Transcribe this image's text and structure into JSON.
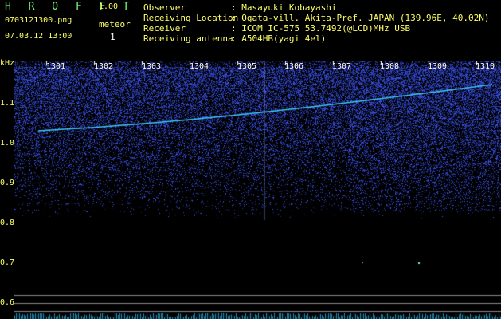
{
  "header": {
    "app_title": "H R O F F T",
    "version": "1.00",
    "file_name": "0703121300.png",
    "meteor_label": "meteor",
    "meteor_count": "1",
    "timestamp": "07.03.12 13:00",
    "info": [
      {
        "key": "Observer",
        "value": ": Masayuki Kobayashi"
      },
      {
        "key": "Receiving Location",
        "value": ": Ogata-vill. Akita-Pref. JAPAN (139.96E, 40.02N)"
      },
      {
        "key": "Receiver",
        "value": ": ICOM IC-575 53.7492(@LCD)MHz USB"
      },
      {
        "key": "Receiving antenna",
        "value": ": A504HB(yagi 4el)"
      }
    ]
  },
  "spectrogram": {
    "unit_label": "kHz",
    "y_ticks": [
      "1.1",
      "1.0",
      "0.9",
      "0.8",
      "0.7",
      "0.6"
    ],
    "time_ticks": [
      "1301",
      "1302",
      "1303",
      "1304",
      "1305",
      "1306",
      "1307",
      "1308",
      "1309",
      "1310"
    ],
    "colors": {
      "background": "#000000",
      "noise": "#2a3cff",
      "signal": "#a0c8ff",
      "grid": "#888888",
      "trace": "#3fc6ff"
    }
  }
}
